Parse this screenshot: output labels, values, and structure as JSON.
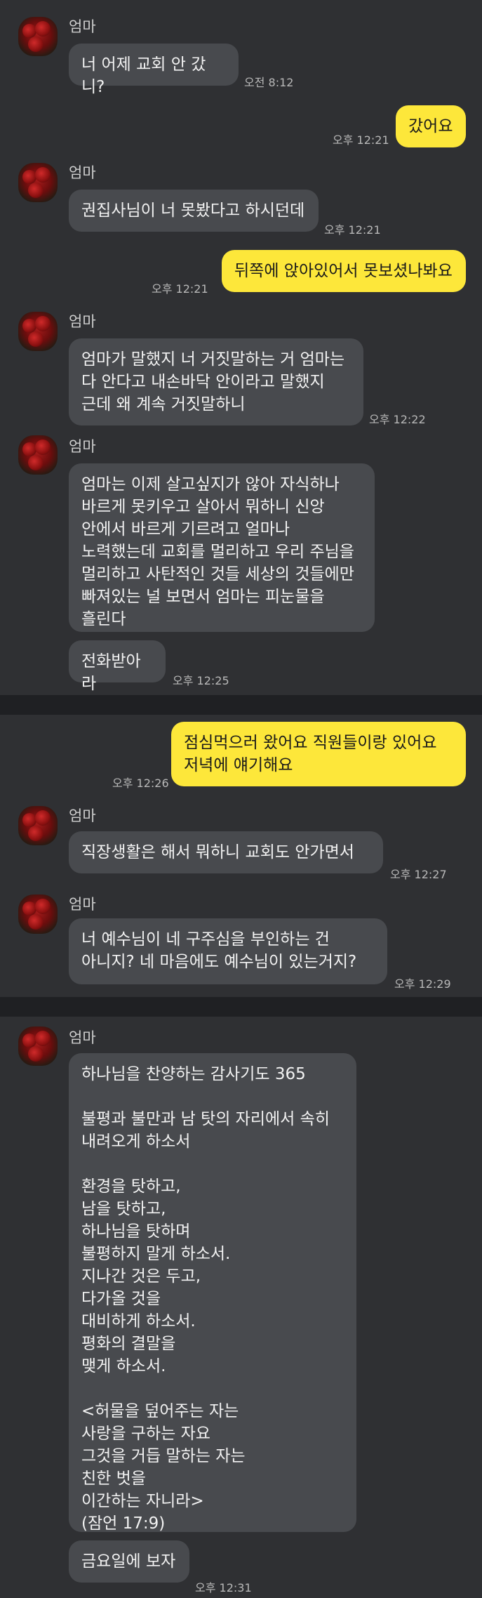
{
  "sender": "엄마",
  "messages": [
    {
      "text": "너 어제 교회 안 갔니?",
      "time": "오전 8:12"
    },
    {
      "text": "갔어요",
      "time": "오후 12:21"
    },
    {
      "text": "권집사님이 너 못봤다고 하시던데",
      "time": "오후 12:21"
    },
    {
      "text": "뒤쪽에 앉아있어서 못보셨나봐요",
      "time": "오후 12:21"
    },
    {
      "text": "엄마가 말했지 너 거짓말하는 거 엄마는\n다 안다고 내손바닥 안이라고 말했지\n근데 왜 계속 거짓말하니",
      "time": "오후 12:22"
    },
    {
      "text": "엄마는 이제 살고싶지가 않아 자식하나\n바르게 못키우고 살아서 뭐하니 신앙\n안에서 바르게 기르려고 얼마나\n노력했는데 교회를 멀리하고 우리 주님을\n멀리하고 사탄적인 것들 세상의 것들에만\n빠져있는 널 보면서 엄마는 피눈물을\n흘린다"
    },
    {
      "text": "전화받아라",
      "time": "오후 12:25"
    },
    {
      "text": "점심먹으러 왔어요 직원들이랑 있어요\n저녁에 얘기해요",
      "time": "오후 12:26"
    },
    {
      "text": "직장생활은 해서 뭐하니 교회도 안가면서",
      "time": "오후 12:27"
    },
    {
      "text": "너 예수님이 네 구주심을 부인하는 건\n아니지? 네 마음에도 예수님이 있는거지?",
      "time": "오후 12:29"
    },
    {
      "text": "하나님을 찬양하는 감사기도 365\n\n불평과 불만과 남 탓의 자리에서 속히\n내려오게 하소서\n\n환경을 탓하고,\n남을 탓하고,\n하나님을 탓하며\n불평하지 말게 하소서.\n지나간 것은 두고,\n다가올 것을\n대비하게 하소서.\n평화의 결말을\n맺게 하소서.\n\n<허물을 덮어주는 자는\n사랑을 구하는 자요\n그것을 거듭 말하는 자는\n친한 벗을\n이간하는 자니라>\n(잠언 17:9)"
    },
    {
      "text": "금요일에 보자",
      "time": "오후 12:31"
    }
  ],
  "colors": {
    "background": "#2f3033",
    "separator": "#1f2023",
    "incoming_bubble": "#484a4e",
    "outgoing_bubble": "#fde73a",
    "timestamp": "#b9b9b9"
  }
}
